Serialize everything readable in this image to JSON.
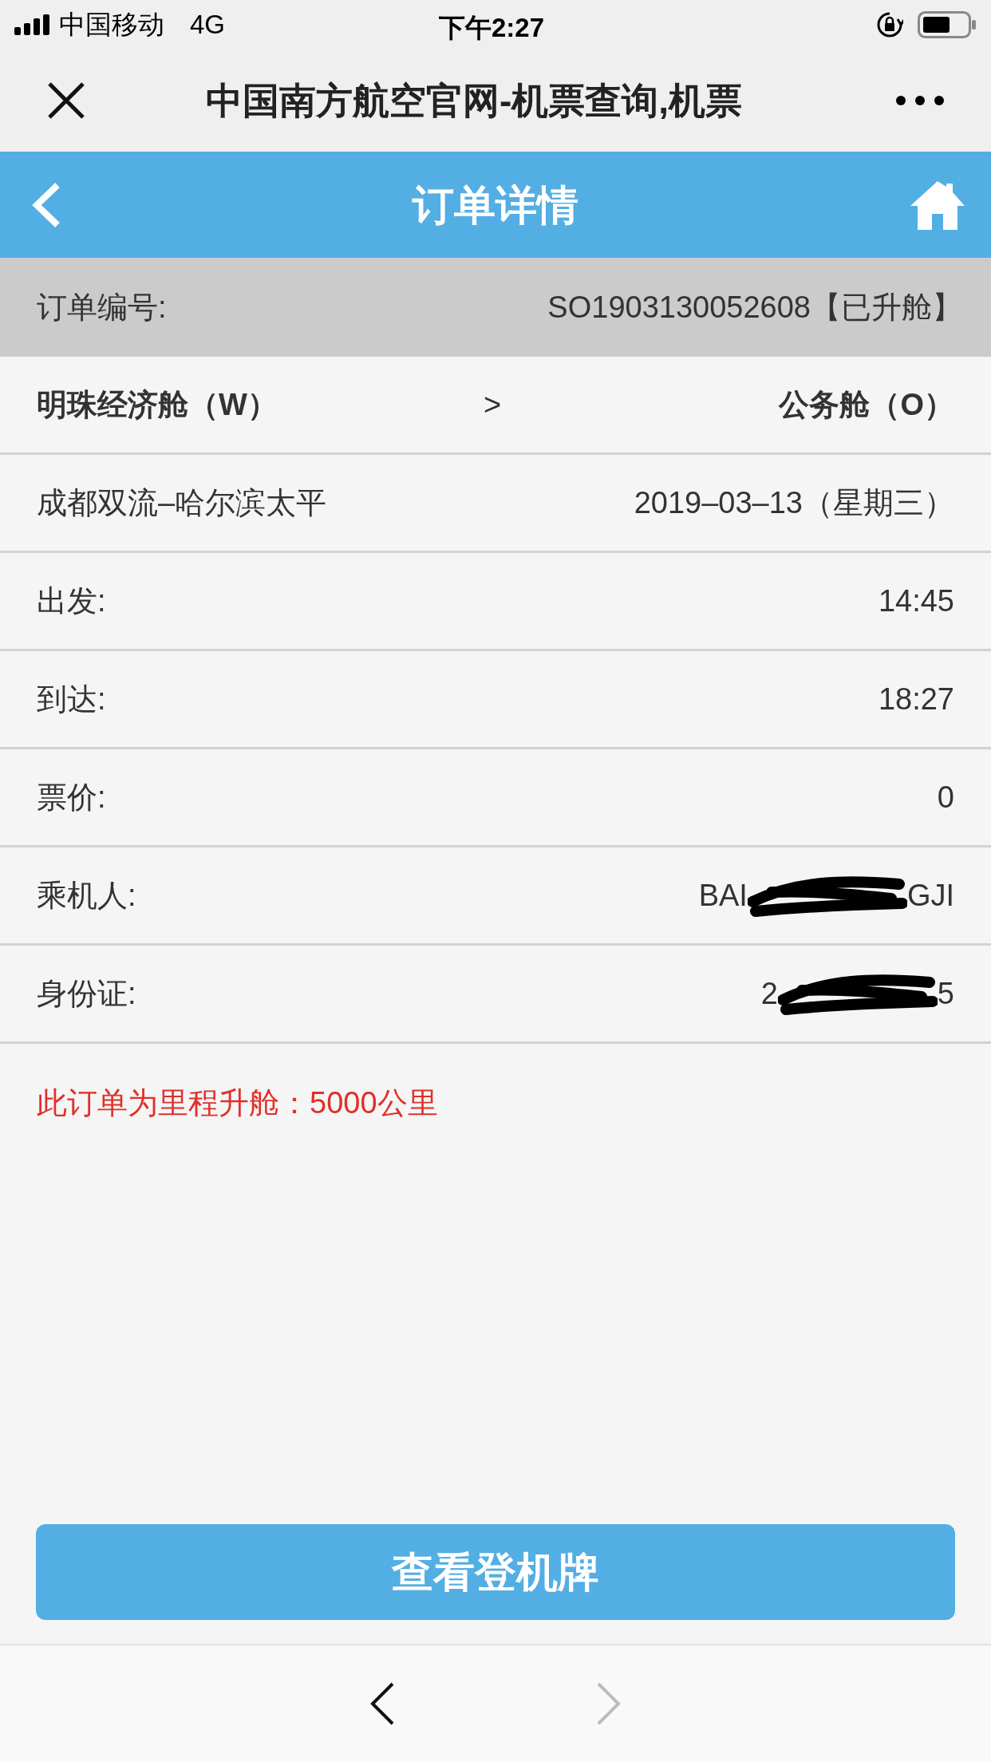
{
  "status_bar": {
    "carrier": "中国移动",
    "network": "4G",
    "time": "下午2:27"
  },
  "browser": {
    "title": "中国南方航空官网-机票查询,机票"
  },
  "header": {
    "title": "订单详情"
  },
  "order": {
    "label": "订单编号:",
    "value": "SO1903130052608【已升舱】"
  },
  "rows": [
    {
      "kind": "cabin",
      "from": "明珠经济舱（W）",
      "arrow": ">",
      "to": "公务舱（O）"
    },
    {
      "kind": "pair",
      "label": "成都双流–哈尔滨太平",
      "value": "2019–03–13（星期三）"
    },
    {
      "kind": "pair",
      "label": "出发:",
      "value": "14:45"
    },
    {
      "kind": "pair",
      "label": "到达:",
      "value": "18:27"
    },
    {
      "kind": "pair",
      "label": "票价:",
      "value": "0"
    },
    {
      "kind": "redacted",
      "label": "乘机人:",
      "value_start": "BAI",
      "value_end": "GJI"
    },
    {
      "kind": "redacted",
      "label": "身份证:",
      "value_start": "2",
      "value_end": "5"
    }
  ],
  "note": "此订单为里程升舱：5000公里",
  "button": "查看登机牌"
}
